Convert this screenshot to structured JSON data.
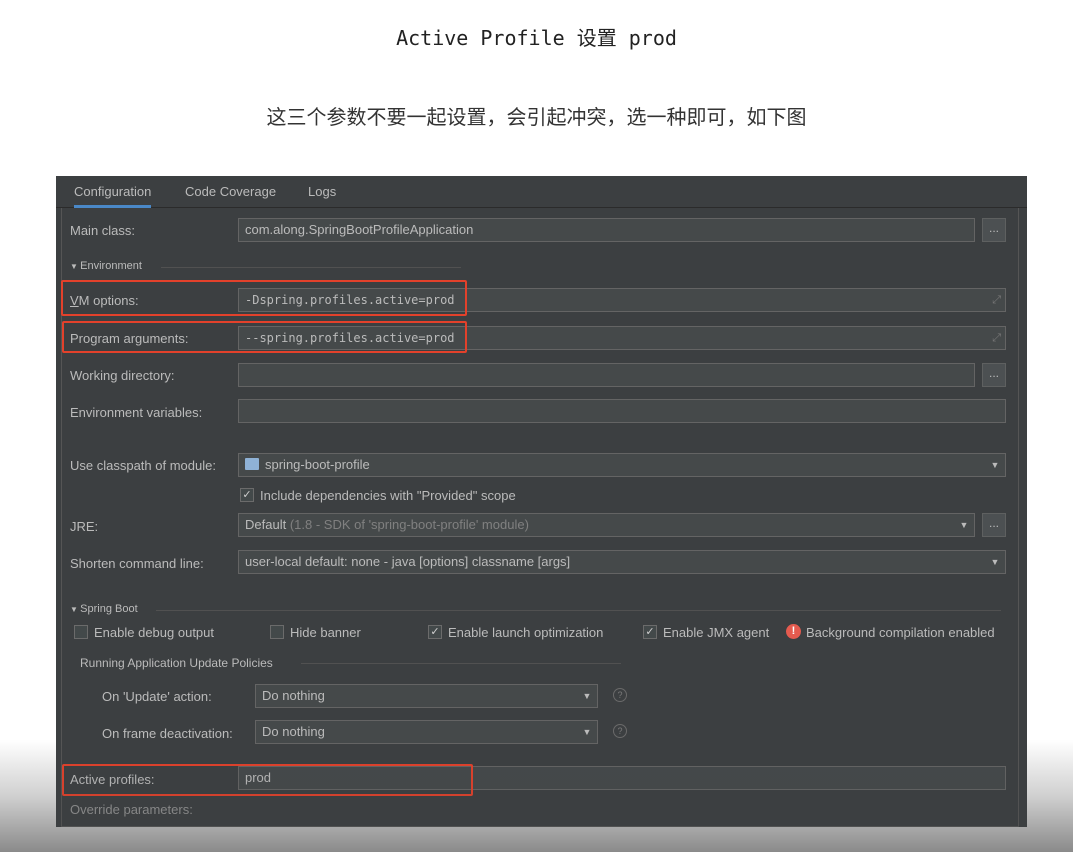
{
  "article": {
    "heading": "Active Profile 设置 prod",
    "subtext": "这三个参数不要一起设置，会引起冲突，选一种即可，如下图"
  },
  "tabs": [
    {
      "label": "Configuration"
    },
    {
      "label": "Code Coverage"
    },
    {
      "label": "Logs"
    }
  ],
  "main_class": {
    "label": "Main class:",
    "value": "com.along.SpringBootProfileApplication",
    "button": "..."
  },
  "environment": {
    "section_label": "Environment",
    "vm_options": {
      "label": "VM options:",
      "value": "-Dspring.profiles.active=prod"
    },
    "program_arguments": {
      "label": "Program arguments:",
      "value": "--spring.profiles.active=prod"
    },
    "working_directory": {
      "label": "Working directory:",
      "value": ""
    },
    "environment_variables": {
      "label": "Environment variables:",
      "value": ""
    }
  },
  "classpath": {
    "label": "Use classpath of module:",
    "value": "spring-boot-profile"
  },
  "include_dependencies": {
    "label": "Include dependencies with \"Provided\" scope",
    "checked": true
  },
  "jre": {
    "label": "JRE:",
    "value": "Default",
    "detail": "(1.8 - SDK of 'spring-boot-profile' module)",
    "button": "..."
  },
  "shorten_command_line": {
    "label": "Shorten command line:",
    "value": "user-local default: none - java [options] classname [args]"
  },
  "spring_boot": {
    "section_label": "Spring Boot",
    "enable_debug_output": {
      "label": "Enable debug output",
      "checked": false
    },
    "hide_banner": {
      "label": "Hide banner",
      "checked": false
    },
    "enable_launch_optimization": {
      "label": "Enable launch optimization",
      "checked": true
    },
    "enable_jmx_agent": {
      "label": "Enable JMX agent",
      "checked": true
    },
    "background_compilation": {
      "label": "Background compilation enabled"
    },
    "update_policies_label": "Running Application Update Policies",
    "on_update_action": {
      "label": "On 'Update' action:",
      "value": "Do nothing"
    },
    "on_frame_deactivation": {
      "label": "On frame deactivation:",
      "value": "Do nothing"
    }
  },
  "active_profiles": {
    "label": "Active profiles:",
    "value": "prod"
  },
  "override_parameters": {
    "label": "Override parameters:"
  },
  "colors": {
    "ide_background": "#3c3f41",
    "field_background": "#45494a",
    "highlight": "#e3412b",
    "tab_accent": "#4a88c7"
  }
}
